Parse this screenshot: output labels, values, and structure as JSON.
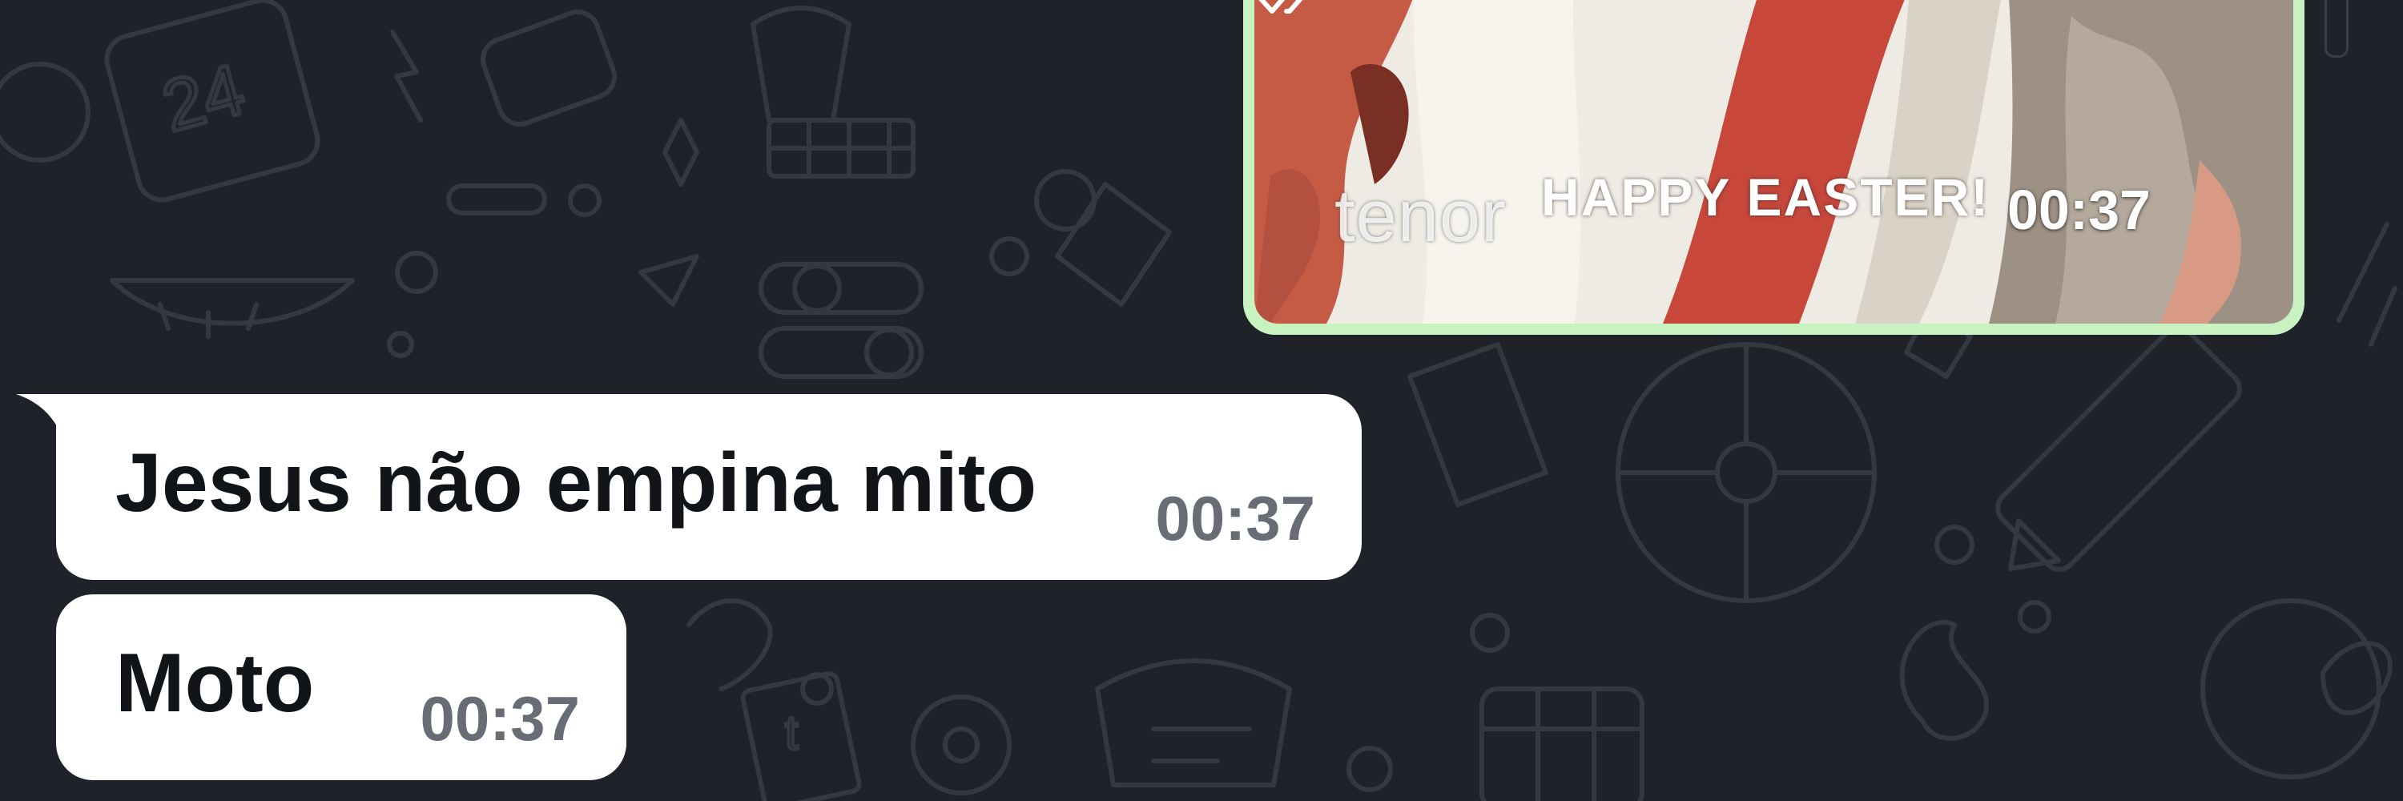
{
  "chat": {
    "gif_message": {
      "watermark": "tenor",
      "caption": "HAPPY EASTER!",
      "time": "00:37",
      "status_icon": "double-check-icon"
    },
    "messages": [
      {
        "text": "Jesus não empina mito",
        "time": "00:37"
      },
      {
        "text": "Moto",
        "time": "00:37"
      }
    ]
  },
  "colors": {
    "background": "#1f2228",
    "incoming_bubble": "#ffffff",
    "outgoing_border": "#c9f2c1",
    "time_text": "#686d75"
  }
}
